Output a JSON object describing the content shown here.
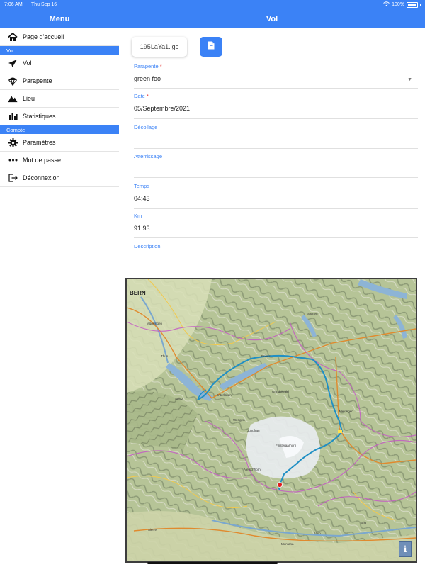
{
  "status": {
    "time": "7:06 AM",
    "date": "Thu Sep 16",
    "battery": "100%"
  },
  "menu": {
    "title": "Menu",
    "home": "Page d'accueil",
    "section_vol": "Vol",
    "items_vol": [
      "Vol",
      "Parapente",
      "Lieu",
      "Statistiques"
    ],
    "section_compte": "Compte",
    "items_compte": [
      "Paramètres",
      "Mot de passe",
      "Déconnexion"
    ]
  },
  "main": {
    "title": "Vol",
    "file_name": "195LaYa1.igc",
    "fields": {
      "parapente": {
        "label": "Parapente",
        "required": "*",
        "value": "green foo"
      },
      "date": {
        "label": "Date",
        "required": "*",
        "value": "05/Septembre/2021"
      },
      "decollage": {
        "label": "Décollage",
        "value": ""
      },
      "atterrissage": {
        "label": "Atterrissage",
        "value": ""
      },
      "temps": {
        "label": "Temps",
        "value": "04:43"
      },
      "km": {
        "label": "Km",
        "value": "91.93"
      },
      "description": {
        "label": "Description",
        "value": ""
      }
    }
  },
  "map": {
    "city_label": "BERN",
    "place_labels": [
      "Thun",
      "Spiez",
      "Interlaken",
      "Brienz",
      "Sarnen",
      "Meiringen",
      "Wengen",
      "Grindelwald",
      "Jungfrau",
      "Finsteraarhorn",
      "Aletschhorn",
      "Brig",
      "Visp",
      "Sierre",
      "Montana",
      "Münsingen"
    ],
    "info_label": "i",
    "track_color": "#1f8fc4",
    "marker_color": "#e02020"
  },
  "colors": {
    "accent": "#3b82f6"
  }
}
